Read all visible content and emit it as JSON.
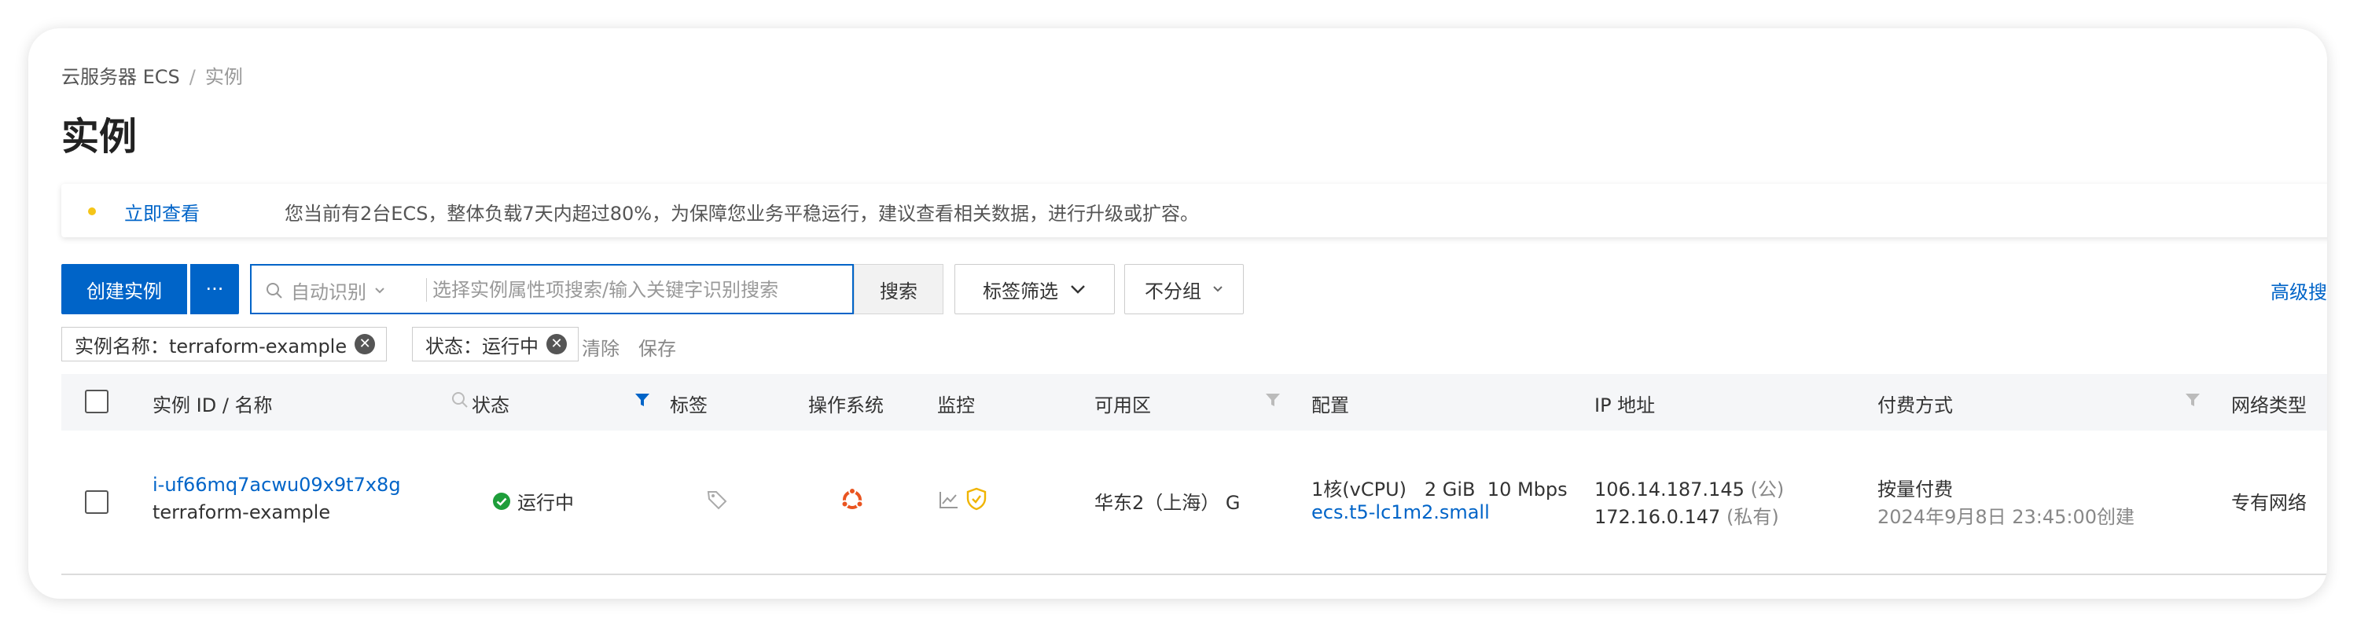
{
  "breadcrumb": {
    "parent": "云服务器 ECS",
    "separator": "/",
    "current": "实例"
  },
  "page_title": "实例",
  "notice": {
    "link": "立即查看",
    "message": "您当前有2台ECS，整体负载7天内超过80%，为保障您业务平稳运行，建议查看相关数据，进行升级或扩容。"
  },
  "toolbar": {
    "create_label": "创建实例",
    "more_label": "···",
    "search_mode": "自动识别",
    "search_placeholder": "选择实例属性项搜索/输入关键字识别搜索",
    "search_button": "搜索",
    "tag_filter": "标签筛选",
    "group": "不分组",
    "advanced": "高级搜"
  },
  "filters": {
    "chips": [
      {
        "label": "实例名称：terraform-example"
      },
      {
        "label": "状态：运行中"
      }
    ],
    "clear": "清除",
    "save": "保存"
  },
  "table": {
    "headers": {
      "id": "实例 ID / 名称",
      "status": "状态",
      "tags": "标签",
      "os": "操作系统",
      "monitor": "监控",
      "zone": "可用区",
      "config": "配置",
      "ip": "IP 地址",
      "billing": "付费方式",
      "network": "网络类型"
    },
    "rows": [
      {
        "instance_id": "i-uf66mq7acwu09x9t7x8g",
        "name": "terraform-example",
        "status": "运行中",
        "zone": "华东2（上海） G",
        "config_cpu": "1核(vCPU)",
        "config_mem": "2 GiB",
        "config_bw": "10 Mbps",
        "config_type": "ecs.t5-lc1m2.small",
        "ip_public": "106.14.187.145",
        "ip_public_tag": "(公)",
        "ip_private": "172.16.0.147",
        "ip_private_tag": "(私有)",
        "billing": "按量付费",
        "created": "2024年9月8日 23:45:00创建",
        "network": "专有网络"
      }
    ]
  },
  "colors": {
    "accent": "#0064c8",
    "success": "#1e9e3a",
    "warning": "#f5c518",
    "os_ubuntu": "#e95420"
  }
}
